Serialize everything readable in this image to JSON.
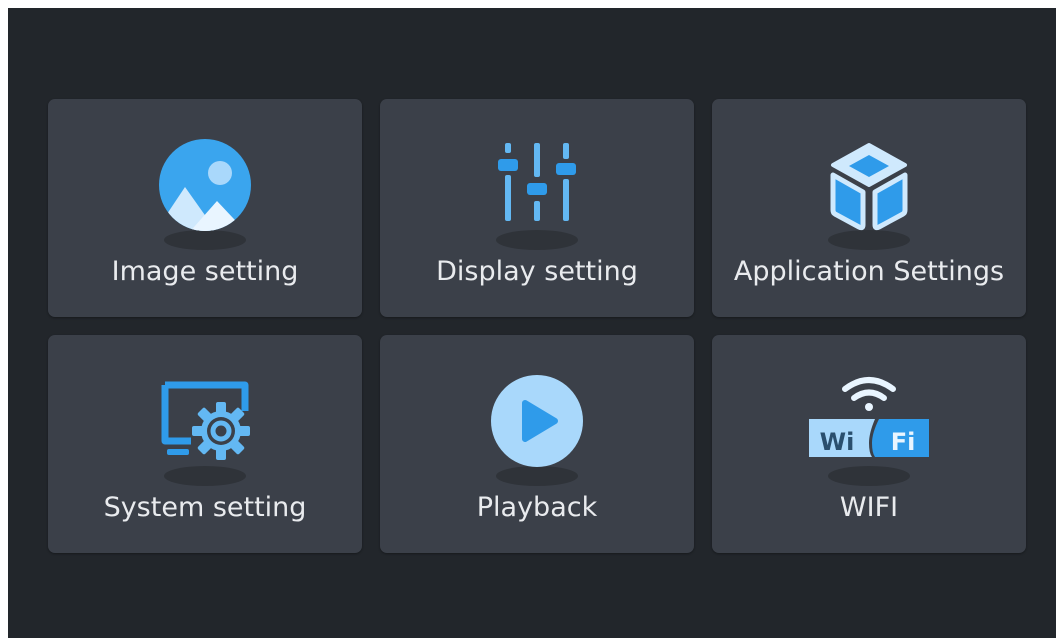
{
  "menu": {
    "tiles": [
      {
        "label": "Image setting",
        "icon": "image-icon"
      },
      {
        "label": "Display setting",
        "icon": "sliders-icon"
      },
      {
        "label": "Application Settings",
        "icon": "cube-icon"
      },
      {
        "label": "System setting",
        "icon": "monitor-gear-icon"
      },
      {
        "label": "Playback",
        "icon": "play-icon"
      },
      {
        "label": "WIFI",
        "icon": "wifi-icon",
        "badge_left": "Wi",
        "badge_right": "Fi"
      }
    ]
  },
  "colors": {
    "background": "#22262b",
    "tile": "#3b4049",
    "accent": "#2f9bea",
    "accent_light": "#63b8f3",
    "text": "#e9ebee"
  }
}
